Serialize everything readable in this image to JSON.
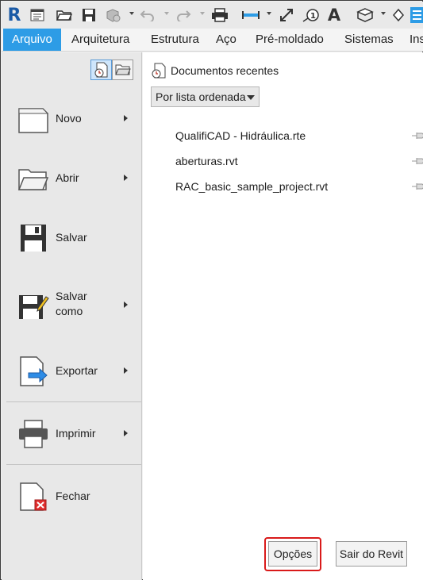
{
  "toolbar": {
    "app_logo": "R",
    "icons": [
      "revit-logo-icon",
      "properties-icon",
      "open-icon",
      "save-icon",
      "sync-icon",
      "undo-icon",
      "redo-icon",
      "print-icon",
      "measure-icon",
      "dimension-icon",
      "tag-icon",
      "text-icon",
      "3d-view-icon",
      "section-icon",
      "switch-windows-icon"
    ],
    "text_icon_label": "A",
    "tag_icon_label": "1"
  },
  "tabs": [
    {
      "label": "Arquivo",
      "active": true
    },
    {
      "label": "Arquitetura"
    },
    {
      "label": "Estrutura"
    },
    {
      "label": "Aço"
    },
    {
      "label": "Pré-moldado"
    },
    {
      "label": "Sistemas"
    },
    {
      "label": "Ins"
    }
  ],
  "left_menu": {
    "items": [
      {
        "label": "Novo",
        "icon": "new-document-icon",
        "has_submenu": true
      },
      {
        "label": "Abrir",
        "icon": "open-folder-icon",
        "has_submenu": true
      },
      {
        "label": "Salvar",
        "icon": "save-icon",
        "has_submenu": false
      },
      {
        "label": "Salvar\ncomo",
        "line1": "Salvar",
        "line2": "como",
        "icon": "save-as-icon",
        "has_submenu": true
      },
      {
        "label": "Exportar",
        "icon": "export-icon",
        "has_submenu": true
      },
      {
        "label": "Imprimir",
        "icon": "print-icon",
        "has_submenu": true
      },
      {
        "label": "Fechar",
        "icon": "close-document-icon",
        "has_submenu": false
      }
    ]
  },
  "recent": {
    "header": "Documentos recentes",
    "sort_selected": "Por lista ordenada",
    "files": [
      "QualifiCAD - Hidráulica.rte",
      "aberturas.rvt",
      "RAC_basic_sample_project.rvt"
    ]
  },
  "footer": {
    "options_label": "Opções",
    "exit_label": "Sair do Revit"
  },
  "colors": {
    "accent": "#2d9ce6",
    "highlight": "#d91a1a"
  }
}
